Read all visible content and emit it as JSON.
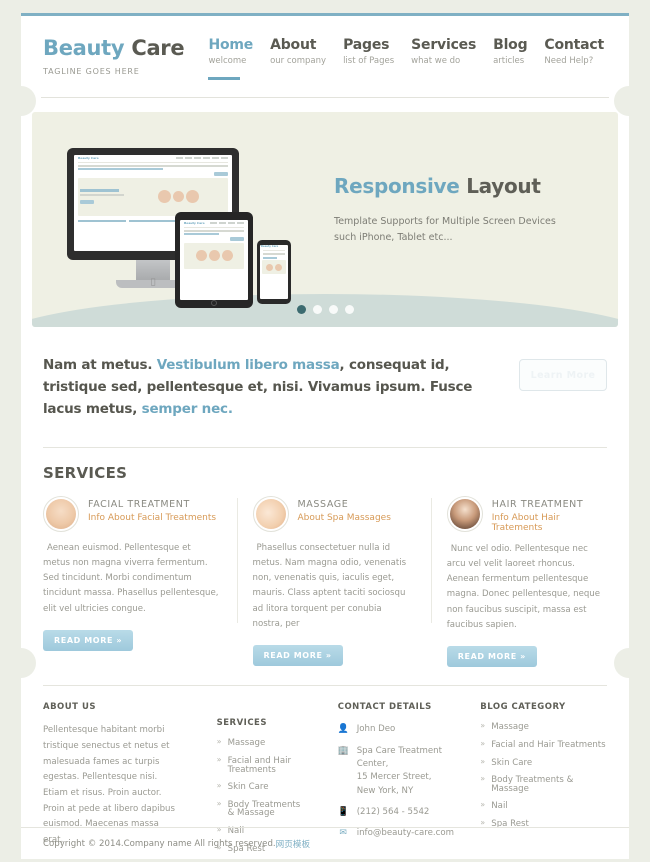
{
  "brand": {
    "name_part1": "Beauty",
    "name_part2": "Care",
    "tagline": "TAGLINE GOES HERE"
  },
  "nav": {
    "items": [
      {
        "label": "Home",
        "sub": "welcome"
      },
      {
        "label": "About",
        "sub": "our company"
      },
      {
        "label": "Pages",
        "sub": "list of Pages"
      },
      {
        "label": "Services",
        "sub": "what we do"
      },
      {
        "label": "Blog",
        "sub": "articles"
      },
      {
        "label": "Contact",
        "sub": "Need Help?"
      }
    ]
  },
  "hero": {
    "title_part1": "Responsive",
    "title_part2": "Layout",
    "sub_line1": "Template Supports for Multiple Screen Devices",
    "sub_line2": "such iPhone, Tablet etc...",
    "dots_total": 4,
    "active_dot": 1
  },
  "intro": {
    "text_a": "Nam at metus. ",
    "text_b": "Vestibulum libero massa",
    "text_c": ", consequat id, tristique sed, pellentesque et, nisi. Vivamus ipsum. Fusce lacus metus, ",
    "text_d": "semper nec.",
    "button_label": "Learn More"
  },
  "services": {
    "heading": "SERVICES",
    "read_more_label": "READ MORE »",
    "items": [
      {
        "name": "FACIAL TREATMENT",
        "sub": "Info About Facial Treatments",
        "body": "Aenean euismod. Pellentesque et metus non magna viverra fermentum. Sed tincidunt. Morbi condimentum tincidunt massa. Phasellus pellentesque, elit vel ultricies congue."
      },
      {
        "name": "MASSAGE",
        "sub": "About Spa Massages",
        "body": "Phasellus consectetuer nulla id metus. Nam magna odio, venenatis non, venenatis quis, iaculis eget, mauris. Class aptent taciti sociosqu ad litora torquent per conubia nostra, per"
      },
      {
        "name": "HAIR TREATMENT",
        "sub": "Info About Hair Tratements",
        "body": "Nunc vel odio. Pellentesque nec arcu vel velit laoreet rhoncus. Aenean fermentum pellentesque magna. Donec pellentesque, neque non faucibus suscipit, massa est faucibus sapien."
      }
    ]
  },
  "footer": {
    "about": {
      "title": "ABOUT US",
      "text": "Pellentesque habitant morbi tristique senectus et netus et malesuada fames ac turpis egestas. Pellentesque nisi. Etiam et risus. Proin auctor. Proin at pede at libero dapibus euismod. Maecenas massa erat,"
    },
    "services": {
      "title": "SERVICES",
      "items": [
        "Massage",
        "Facial and Hair Treatments",
        "Skin Care",
        "Body Treatments & Massage",
        "Nail",
        "Spa Rest"
      ]
    },
    "contact": {
      "title": "CONTACT DETAILS",
      "person": "John Deo",
      "address_line1": "Spa Care Treatment Center,",
      "address_line2": "15 Mercer Street,",
      "address_line3": "New York, NY",
      "phone": "(212) 564 - 5542",
      "email": "info@beauty-care.com",
      "icon_person": "person-icon",
      "icon_address": "building-icon",
      "icon_phone": "phone-icon",
      "icon_email": "envelope-icon"
    },
    "blog": {
      "title": "BLOG CATEGORY",
      "items": [
        "Massage",
        "Facial and Hair Treatments",
        "Skin Care",
        "Body Treatments & Massage",
        "Nail",
        "Spa Rest"
      ]
    }
  },
  "copyright": {
    "text": "Copyright © 2014.Company name All rights reserved.",
    "cn_link": "网页模板"
  },
  "colors": {
    "accent_blue": "#6ea7bf",
    "text_dark": "#5a5a52",
    "text_muted": "#9a9a92",
    "orange": "#d79a57",
    "page_bg": "#eceee6",
    "hero_bg": "#eff0e4"
  }
}
